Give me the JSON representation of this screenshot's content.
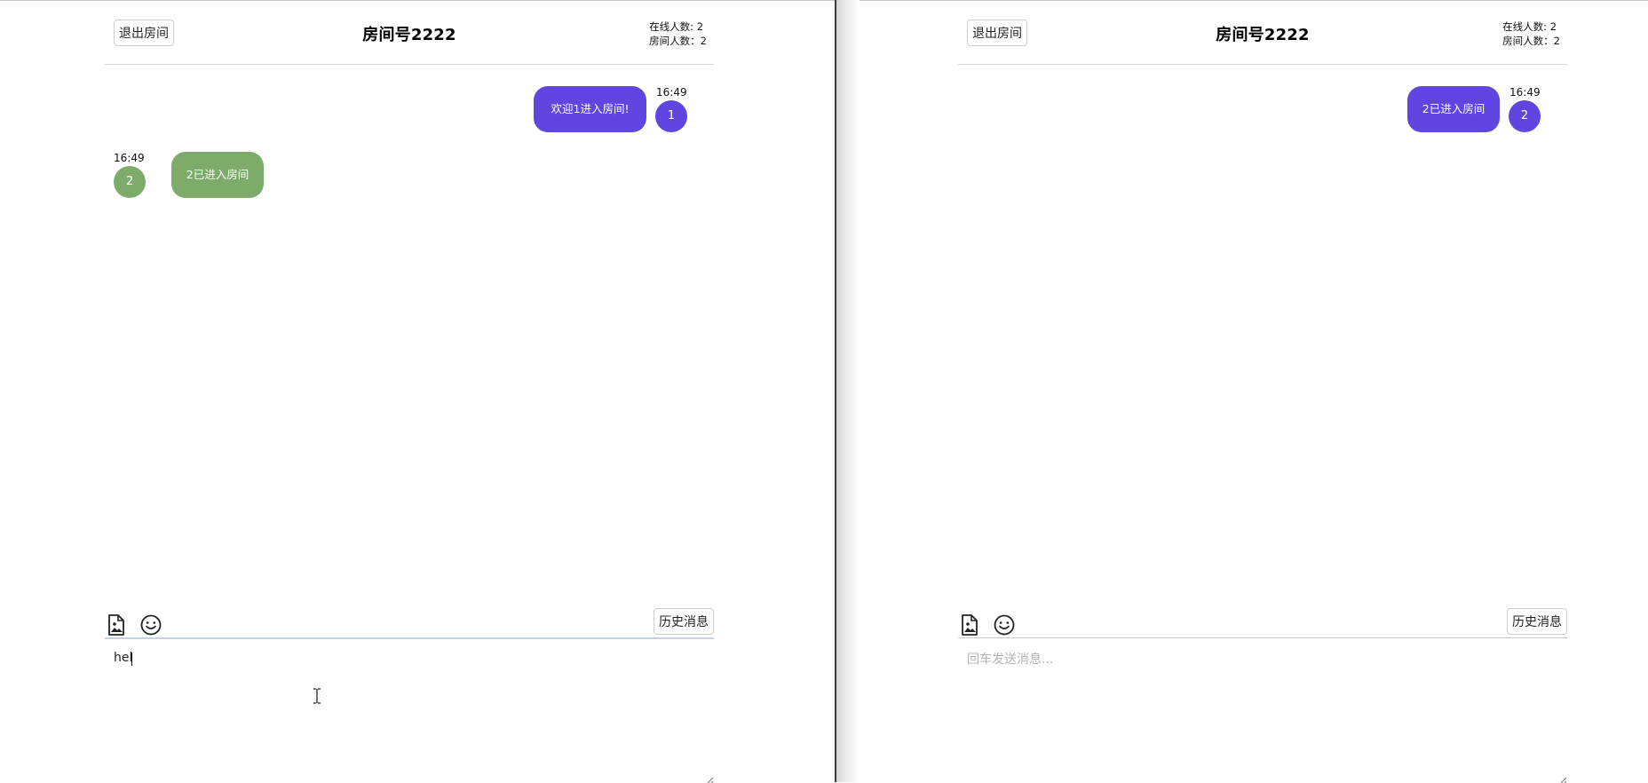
{
  "panes": {
    "left": {
      "header": {
        "exit_label": "退出房间",
        "title": "房间号2222",
        "online_count": "在线人数: 2",
        "room_count": "房间人数：2"
      },
      "messages": [
        {
          "side": "right",
          "text": "欢迎1进入房间!",
          "time": "16:49",
          "avatar": "1",
          "color": "#6045e0"
        },
        {
          "side": "left",
          "text": "2已进入房间",
          "time": "16:49",
          "avatar": "2",
          "color": "#7dab6a"
        }
      ],
      "toolbar": {
        "file_icon": "image-file-icon",
        "emoji_icon": "smiley-icon",
        "history_label": "历史消息"
      },
      "input": {
        "value": "hel",
        "placeholder": "回车发送消息..."
      }
    },
    "right": {
      "header": {
        "exit_label": "退出房间",
        "title": "房间号2222",
        "online_count": "在线人数: 2",
        "room_count": "房间人数：2"
      },
      "messages": [
        {
          "side": "right",
          "text": "2已进入房间",
          "time": "16:49",
          "avatar": "2",
          "color": "#6045e0"
        }
      ],
      "toolbar": {
        "file_icon": "image-file-icon",
        "emoji_icon": "smiley-icon",
        "history_label": "历史消息"
      },
      "input": {
        "value": "",
        "placeholder": "回车发送消息..."
      }
    }
  },
  "colors": {
    "self_bubble": "#6045e0",
    "other_bubble": "#7dab6a",
    "divider": "#3a3a3a"
  }
}
